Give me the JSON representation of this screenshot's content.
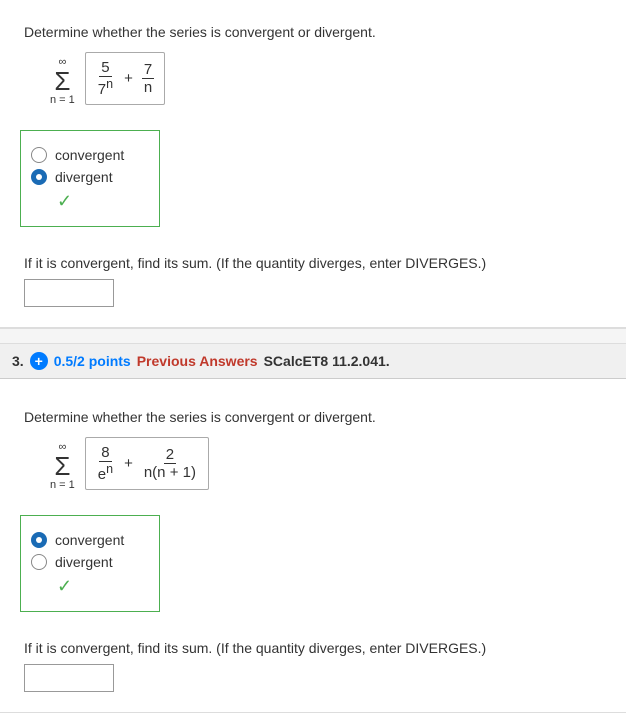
{
  "problem2": {
    "question": "Determine whether the series is convergent or divergent.",
    "formula": {
      "inf": "∞",
      "sum": "Σ",
      "nFrom": "n = 1",
      "frac1Num": "5",
      "frac1Den": "7n",
      "plus": "+",
      "frac2Num": "7",
      "frac2Den": "n"
    },
    "options": {
      "convergent": "convergent",
      "divergent": "divergent"
    },
    "selected": "divergent",
    "subQuestion": "If it is convergent, find its sum. (If the quantity diverges, enter DIVERGES.)",
    "answerPlaceholder": ""
  },
  "problem3": {
    "number": "3.",
    "points": "0.5/2 points",
    "prevAnswers": "Previous Answers",
    "problemId": "SCalcET8 11.2.041.",
    "question": "Determine whether the series is convergent or divergent.",
    "formula": {
      "inf": "∞",
      "sum": "Σ",
      "nFrom": "n = 1",
      "frac1Num": "8",
      "frac1Den": "en",
      "plus": "+",
      "frac2Num": "2",
      "frac2Den": "n(n + 1)"
    },
    "options": {
      "convergent": "convergent",
      "divergent": "divergent"
    },
    "selected": "convergent",
    "subQuestion": "If it is convergent, find its sum. (If the quantity diverges, enter DIVERGES.)",
    "answerPlaceholder": ""
  },
  "colors": {
    "blue": "#1a6bb5",
    "green": "#4caf50",
    "red": "#c0392b"
  }
}
